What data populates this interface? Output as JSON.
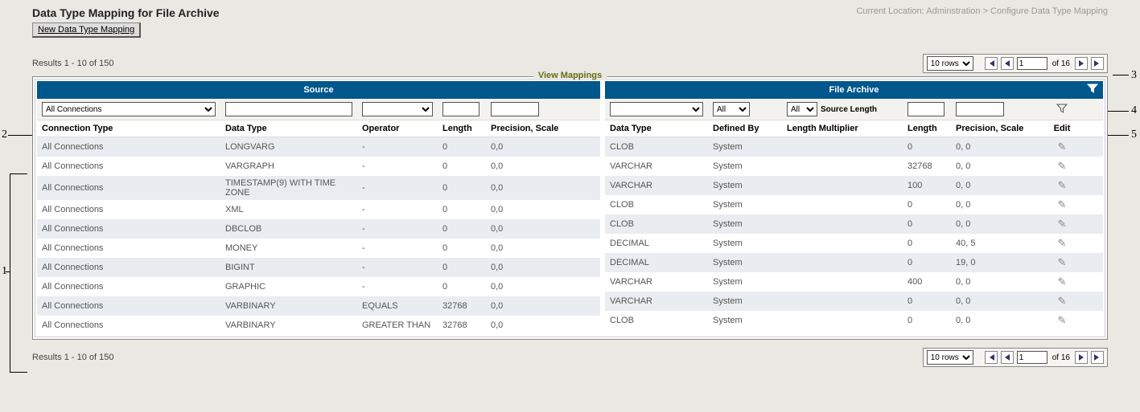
{
  "header": {
    "title": "Data Type Mapping for File Archive",
    "breadcrumb": "Current Location: Adminstration > Configure Data Type Mapping",
    "new_button": "New Data Type Mapping"
  },
  "results_text": "Results 1 - 10 of 150",
  "pager": {
    "rows_label": "10 rows",
    "page_value": "1",
    "of_text": "of 16"
  },
  "fieldset_legend": "View Mappings",
  "source": {
    "section": "Source",
    "filter_conn": "All Connections",
    "cols": {
      "conn": "Connection Type",
      "dtype": "Data Type",
      "op": "Operator",
      "len": "Length",
      "ps": "Precision, Scale"
    }
  },
  "target": {
    "section": "File Archive",
    "filter_defby": "All",
    "filter_lm_sel": "All",
    "filter_lm_label": "Source Length",
    "cols": {
      "dtype": "Data Type",
      "defby": "Defined By",
      "lm": "Length Multiplier",
      "len": "Length",
      "ps": "Precision, Scale",
      "edit": "Edit"
    }
  },
  "rows": [
    {
      "conn": "All Connections",
      "s_dtype": "LONGVARG",
      "op": "-",
      "s_len": "0",
      "s_ps": "0,0",
      "t_dtype": "CLOB",
      "defby": "System",
      "lm": "",
      "t_len": "0",
      "t_ps": "0, 0"
    },
    {
      "conn": "All Connections",
      "s_dtype": "VARGRAPH",
      "op": "-",
      "s_len": "0",
      "s_ps": "0,0",
      "t_dtype": "VARCHAR",
      "defby": "System",
      "lm": "",
      "t_len": "32768",
      "t_ps": "0, 0"
    },
    {
      "conn": "All Connections",
      "s_dtype": "TIMESTAMP(9) WITH TIME ZONE",
      "op": "-",
      "s_len": "0",
      "s_ps": "0,0",
      "t_dtype": "VARCHAR",
      "defby": "System",
      "lm": "",
      "t_len": "100",
      "t_ps": "0, 0"
    },
    {
      "conn": "All Connections",
      "s_dtype": "XML",
      "op": "-",
      "s_len": "0",
      "s_ps": "0,0",
      "t_dtype": "CLOB",
      "defby": "System",
      "lm": "",
      "t_len": "0",
      "t_ps": "0, 0"
    },
    {
      "conn": "All Connections",
      "s_dtype": "DBCLOB",
      "op": "-",
      "s_len": "0",
      "s_ps": "0,0",
      "t_dtype": "CLOB",
      "defby": "System",
      "lm": "",
      "t_len": "0",
      "t_ps": "0, 0"
    },
    {
      "conn": "All Connections",
      "s_dtype": "MONEY",
      "op": "-",
      "s_len": "0",
      "s_ps": "0,0",
      "t_dtype": "DECIMAL",
      "defby": "System",
      "lm": "",
      "t_len": "0",
      "t_ps": "40, 5"
    },
    {
      "conn": "All Connections",
      "s_dtype": "BIGINT",
      "op": "-",
      "s_len": "0",
      "s_ps": "0,0",
      "t_dtype": "DECIMAL",
      "defby": "System",
      "lm": "",
      "t_len": "0",
      "t_ps": "19, 0"
    },
    {
      "conn": "All Connections",
      "s_dtype": "GRAPHIC",
      "op": "-",
      "s_len": "0",
      "s_ps": "0,0",
      "t_dtype": "VARCHAR",
      "defby": "System",
      "lm": "",
      "t_len": "400",
      "t_ps": "0, 0"
    },
    {
      "conn": "All Connections",
      "s_dtype": "VARBINARY",
      "op": "EQUALS",
      "s_len": "32768",
      "s_ps": "0,0",
      "t_dtype": "VARCHAR",
      "defby": "System",
      "lm": "",
      "t_len": "0",
      "t_ps": "0, 0"
    },
    {
      "conn": "All Connections",
      "s_dtype": "VARBINARY",
      "op": "GREATER THAN",
      "s_len": "32768",
      "s_ps": "0,0",
      "t_dtype": "CLOB",
      "defby": "System",
      "lm": "",
      "t_len": "0",
      "t_ps": "0, 0"
    }
  ],
  "annotations": {
    "a1": "1",
    "a2": "2",
    "a3": "3",
    "a4": "4",
    "a5": "5"
  }
}
